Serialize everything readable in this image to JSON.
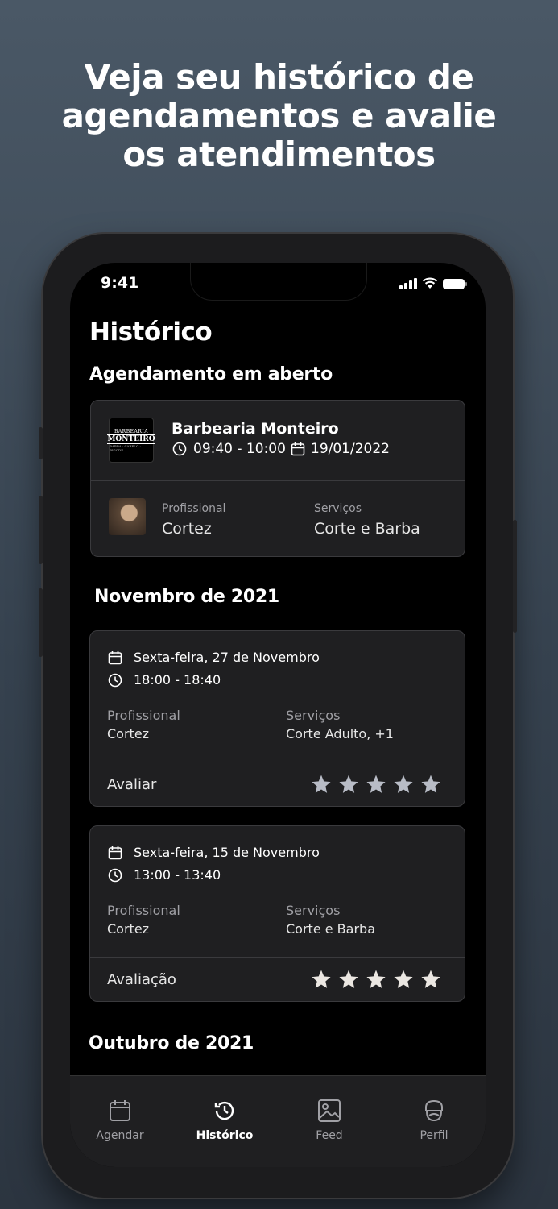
{
  "headline": {
    "line1": "Veja seu histórico de",
    "line2": "agendamentos e avalie",
    "line3": "os atendimentos"
  },
  "status_bar": {
    "time": "9:41"
  },
  "page": {
    "title": "Histórico"
  },
  "open_section": {
    "title": "Agendamento em aberto",
    "card": {
      "logo": {
        "line1": "BARBEARIA",
        "line2": "MONTEIRO",
        "line3": "BARBA · CABELO · BIGODE"
      },
      "shop_name": "Barbearia Monteiro",
      "time": "09:40 - 10:00",
      "date": "19/01/2022",
      "professional_label": "Profissional",
      "professional": "Cortez",
      "services_label": "Serviços",
      "services": "Corte e Barba"
    }
  },
  "months": [
    {
      "title": "Novembro de 2021",
      "entries": [
        {
          "date": "Sexta-feira, 27 de Novembro",
          "time": "18:00 - 18:40",
          "professional_label": "Profissional",
          "professional": "Cortez",
          "services_label": "Serviços",
          "services": "Corte Adulto, +1",
          "rating_label": "Avaliar",
          "rating": 0,
          "star_color": "#b8bcc6"
        },
        {
          "date": "Sexta-feira, 15 de Novembro",
          "time": "13:00 - 13:40",
          "professional_label": "Profissional",
          "professional": "Cortez",
          "services_label": "Serviços",
          "services": "Corte e Barba",
          "rating_label": "Avaliação",
          "rating": 5,
          "star_color": "#ebe7e2"
        }
      ]
    },
    {
      "title": "Outubro de 2021"
    }
  ],
  "tabbar": {
    "tabs": [
      {
        "label": "Agendar",
        "icon": "calendar-icon",
        "active": false
      },
      {
        "label": "Histórico",
        "icon": "history-icon",
        "active": true
      },
      {
        "label": "Feed",
        "icon": "image-icon",
        "active": false
      },
      {
        "label": "Perfil",
        "icon": "barber-profile-icon",
        "active": false
      }
    ]
  },
  "colors": {
    "background": "#3f4b58",
    "card": "#1f1f21",
    "card_border": "#3a3a3d",
    "secondary_text": "#a0a0a5"
  }
}
